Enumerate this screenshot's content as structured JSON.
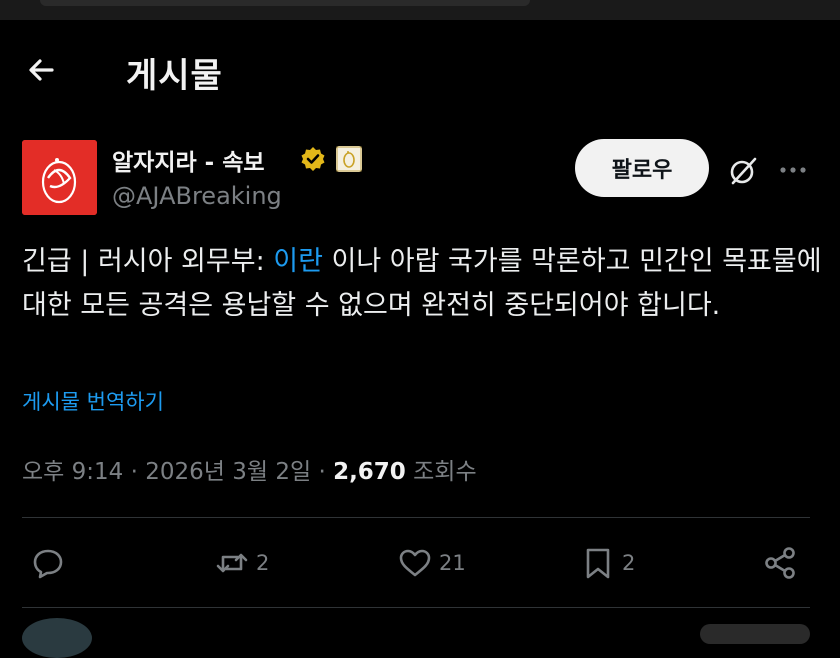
{
  "header": {
    "title": "게시물"
  },
  "author": {
    "name": "알자지라 - 속보",
    "handle": "@AJABreaking",
    "follow_label": "팔로우"
  },
  "post": {
    "text_before": "긴급 | 러시아 외무부: ",
    "link_text": "이란",
    "text_after": " 이나 아랍 국가를 막론하고 민간인 목표물에 대한 모든 공격은 용납할 수 없으며 완전히 중단되어야 합니다.",
    "translate_label": "게시물 번역하기"
  },
  "meta": {
    "time": "오후 9:14",
    "separator": "·",
    "date": "2026년 3월 2일",
    "views_count": "2,670",
    "views_label": "조회수"
  },
  "actions": {
    "reply_count": "",
    "repost_count": "2",
    "like_count": "21",
    "bookmark_count": "2"
  },
  "colors": {
    "background": "#000000",
    "link": "#1d9bf0",
    "avatar_bg": "#e32d27",
    "verified": "#e2b719",
    "muted_text": "#7c8084"
  },
  "icons": [
    "back-arrow-icon",
    "verified-badge-icon",
    "affiliate-badge-icon",
    "grok-icon",
    "more-icon",
    "reply-icon",
    "repost-icon",
    "like-icon",
    "bookmark-icon",
    "share-icon"
  ]
}
